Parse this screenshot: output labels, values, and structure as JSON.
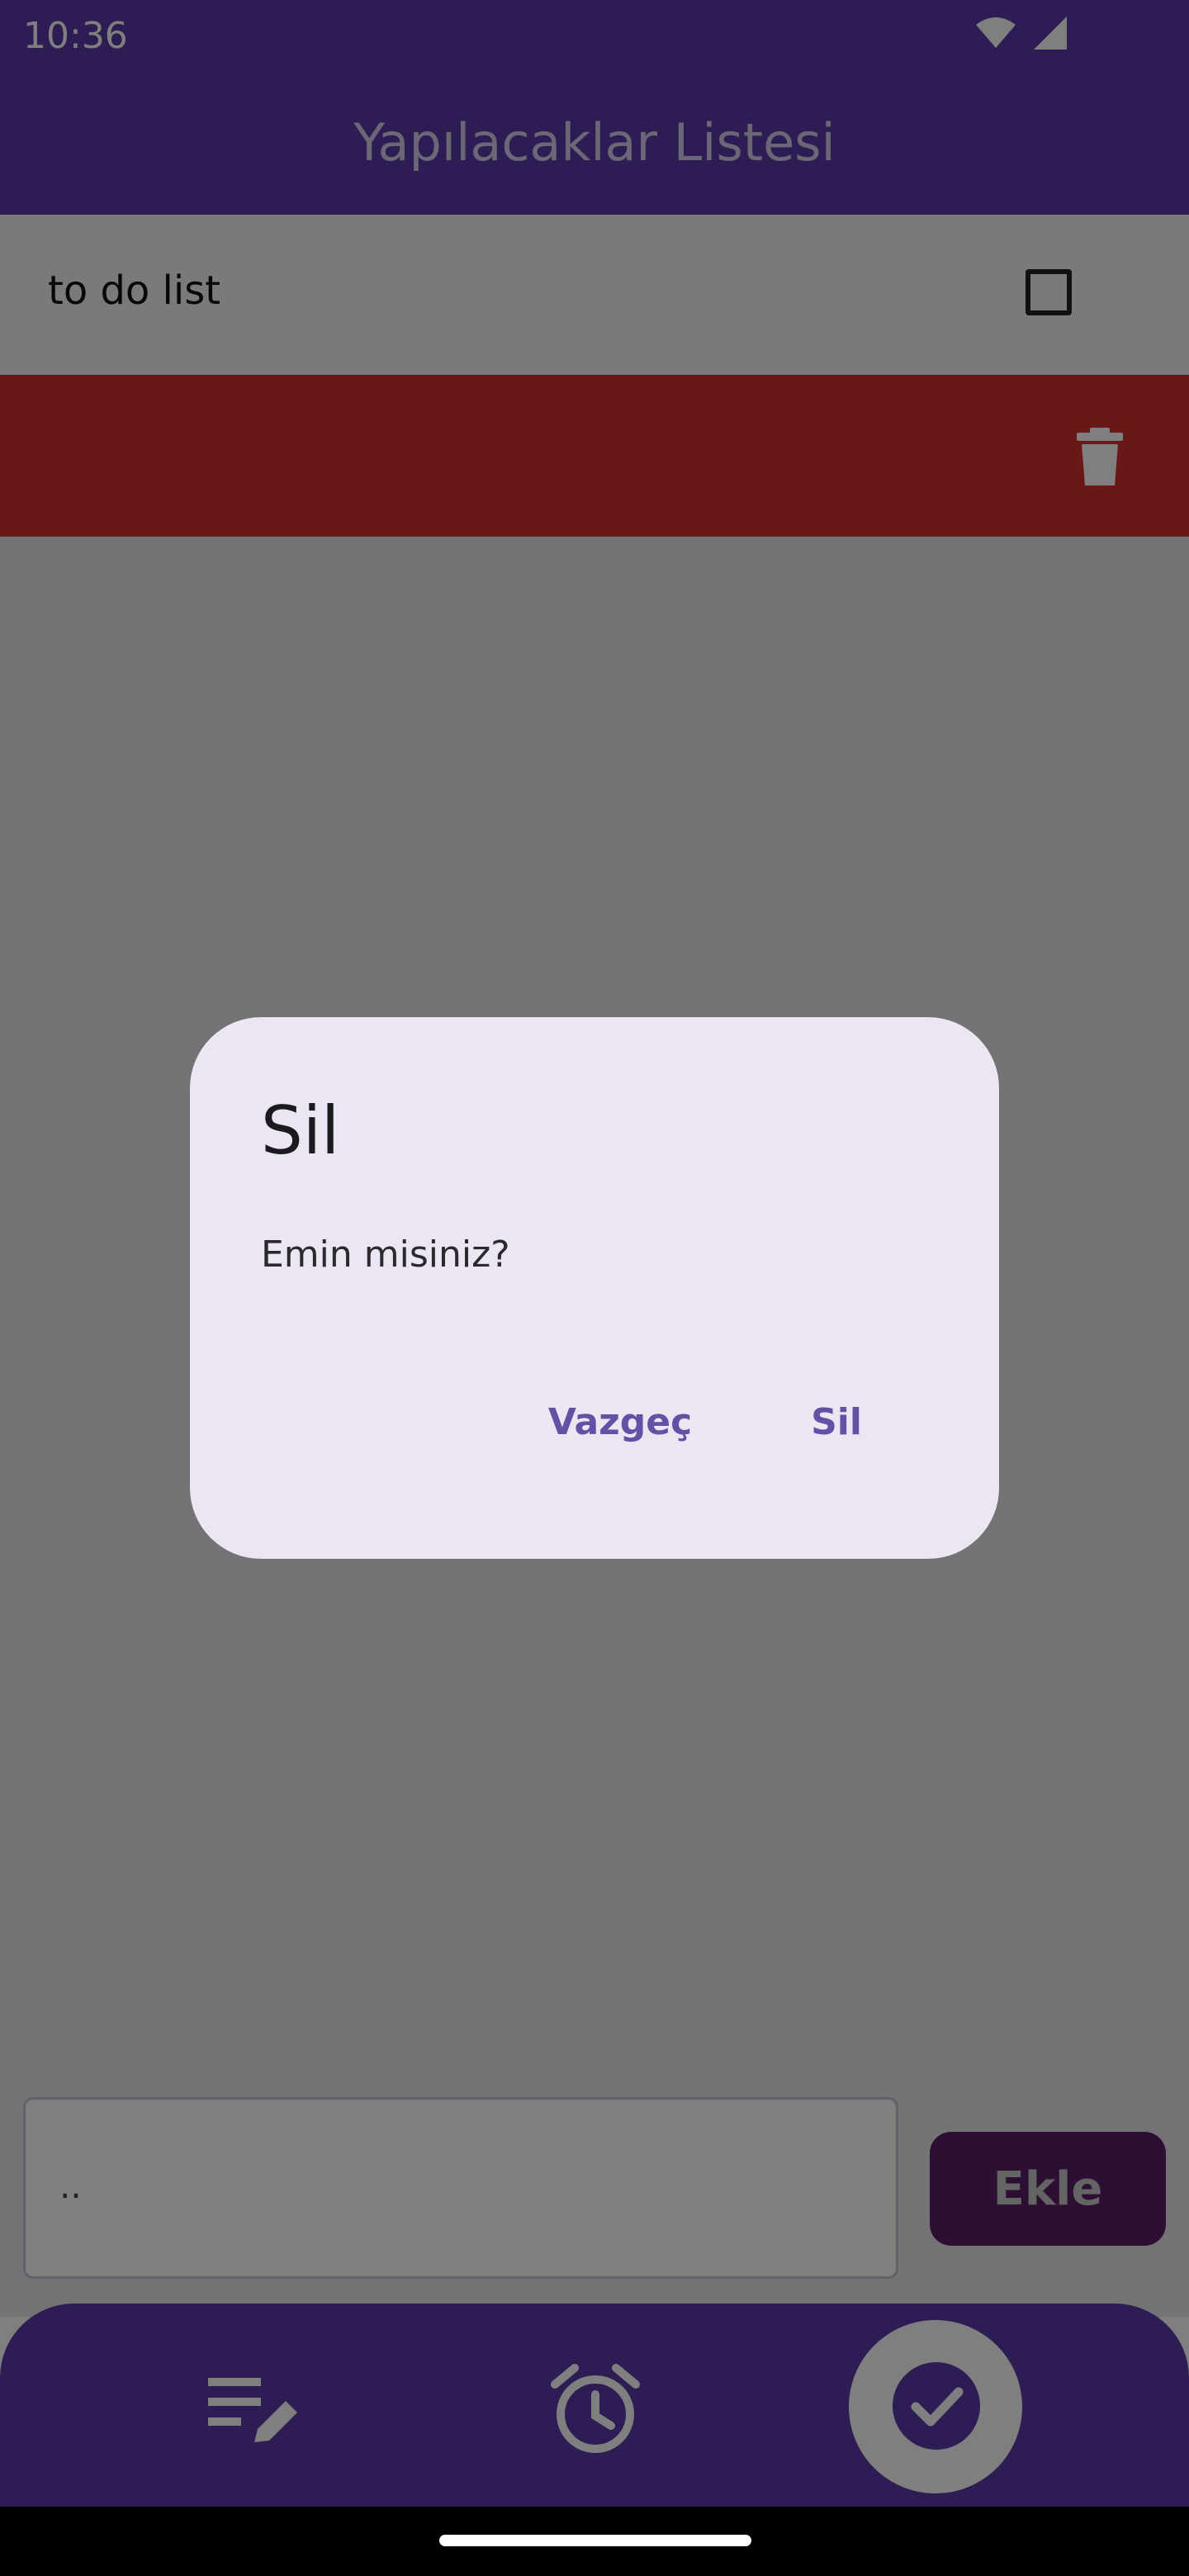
{
  "status_bar": {
    "time": "10:36",
    "icons": [
      "wifi-icon",
      "cellular-signal-icon"
    ]
  },
  "app_bar": {
    "title": "Yapılacaklar Listesi"
  },
  "todos": [
    {
      "text": "to do list",
      "checked": false
    }
  ],
  "delete_row": {
    "icon": "trash-icon",
    "color": "#d32f2f"
  },
  "input": {
    "value": ".."
  },
  "add_button": {
    "label": "Ekle"
  },
  "bottom_nav": {
    "items": [
      {
        "icon": "edit-list-icon",
        "active": false
      },
      {
        "icon": "alarm-icon",
        "active": false
      },
      {
        "icon": "check-icon",
        "active": true
      }
    ]
  },
  "dialog": {
    "title": "Sil",
    "message": "Emin misiniz?",
    "cancel_label": "Vazgeç",
    "confirm_label": "Sil"
  },
  "colors": {
    "primary": "#5a3ba8",
    "dialog_bg": "#ece6f2",
    "dialog_action": "#6451a6",
    "add_button": "#5b1f66"
  }
}
